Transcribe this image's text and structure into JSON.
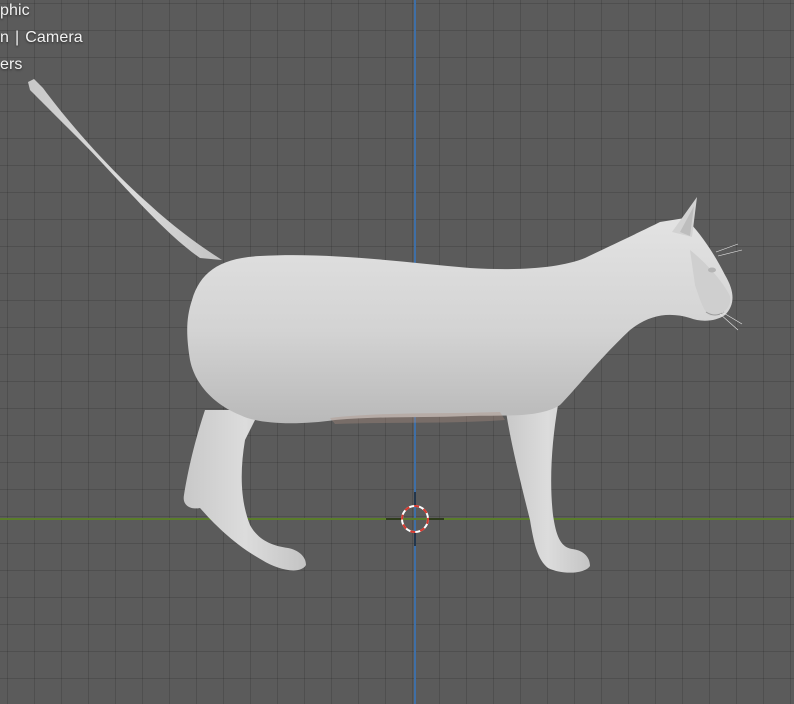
{
  "viewport": {
    "view_mode_text": "phic",
    "collection": {
      "left_text": "n",
      "separator": "|",
      "object_text": "Camera"
    },
    "overlay_extra_text": "ers",
    "subject_icon": "cat-model",
    "cursor_icon": "3d-cursor-icon",
    "colors": {
      "background": "#5b5b5b",
      "grid": "#4e4e4e",
      "y_axis": "#3f6fa6",
      "x_axis": "#5a7d2b",
      "model": "#d6d6d6"
    }
  }
}
